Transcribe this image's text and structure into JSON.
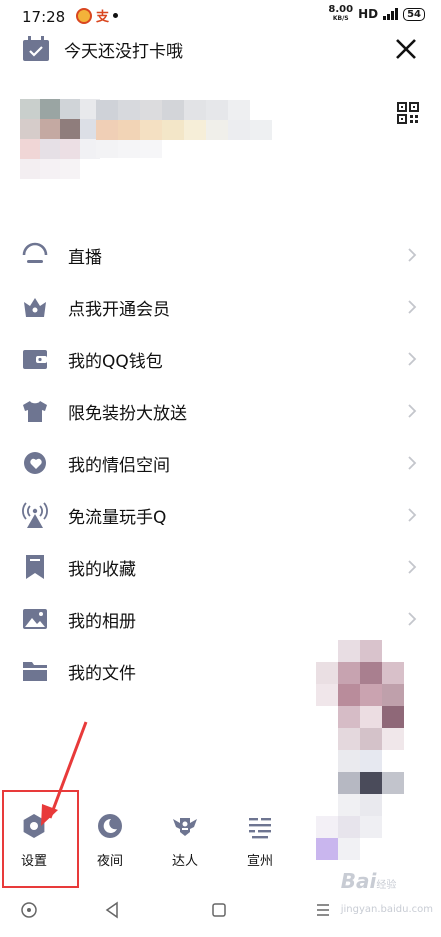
{
  "status_bar": {
    "time": "17:28",
    "app_glyph": "支",
    "speed_value": "8.00",
    "speed_unit": "KB/S",
    "hd": "HD",
    "battery": "54"
  },
  "header": {
    "checkin_text": "今天还没打卡哦"
  },
  "menu": {
    "items": [
      {
        "label": "直播",
        "icon": "live-icon"
      },
      {
        "label": "点我开通会员",
        "icon": "vip-crown-icon"
      },
      {
        "label": "我的QQ钱包",
        "icon": "wallet-icon"
      },
      {
        "label": "限免装扮大放送",
        "icon": "shirt-icon"
      },
      {
        "label": "我的情侣空间",
        "icon": "couple-heart-icon"
      },
      {
        "label": "免流量玩手Q",
        "icon": "signal-tower-icon"
      },
      {
        "label": "我的收藏",
        "icon": "bookmark-icon"
      },
      {
        "label": "我的相册",
        "icon": "photo-icon"
      },
      {
        "label": "我的文件",
        "icon": "folder-icon"
      }
    ]
  },
  "bottom_bar": {
    "settings": "设置",
    "night": "夜间",
    "expert": "达人",
    "city": "宣州"
  },
  "watermark": {
    "brand": "Bai",
    "brand_sub": "经验",
    "url": "jingyan.baidu.com"
  },
  "colors": {
    "icon": "#6e7591",
    "highlight": "#e83a3a",
    "chevron": "#c4c6cc"
  }
}
